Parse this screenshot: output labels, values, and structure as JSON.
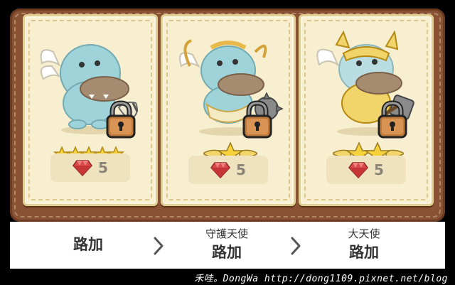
{
  "cards": [
    {
      "character": "blue-crocodile-angel",
      "stars": 5,
      "star_style": "small-row",
      "price": "5",
      "locked": true
    },
    {
      "character": "armored-crocodile-angel-guardian",
      "stars": 1,
      "star_style": "winged-badge",
      "price": "5",
      "locked": true
    },
    {
      "character": "golden-crocodile-archangel",
      "stars": 2,
      "star_style": "winged-badge",
      "price": "5",
      "locked": true
    }
  ],
  "evolution": [
    {
      "title": "",
      "name": "路加"
    },
    {
      "title": "守護天使",
      "name": "路加"
    },
    {
      "title": "大天使",
      "name": "路加"
    }
  ],
  "footer": {
    "text": "禾哇。DongWa http://dong1109.pixnet.net/blog"
  },
  "colors": {
    "board": "#8a5234",
    "card_bg": "#f7efd0",
    "star": "#f5d23c",
    "gem": "#d94a4a",
    "lock": "#c07a3a"
  },
  "icons": [
    "padlock-icon",
    "ruby-gem-icon",
    "star-icon",
    "chevron-right-icon"
  ]
}
